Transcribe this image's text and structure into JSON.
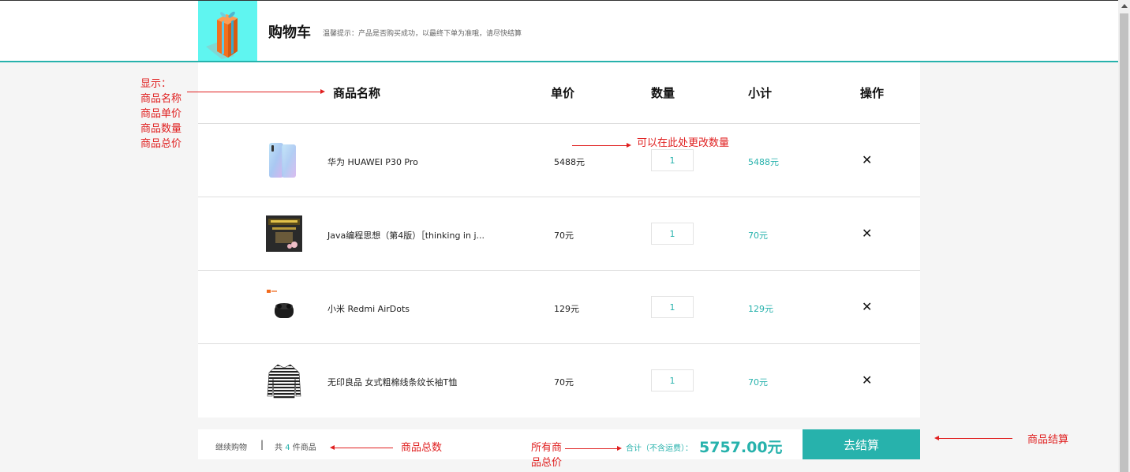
{
  "header": {
    "title": "购物车",
    "tip": "温馨提示：产品是否购买成功，以最终下单为准哦，请尽快结算"
  },
  "table": {
    "headers": {
      "name": "商品名称",
      "price": "单价",
      "quantity": "数量",
      "subtotal": "小计",
      "action": "操作"
    },
    "rows": [
      {
        "name": "华为 HUAWEI P30 Pro",
        "price": "5488元",
        "quantity": "1",
        "subtotal": "5488元",
        "delete": "✕"
      },
      {
        "name": "Java编程思想（第4版）［thinking in j...",
        "price": "70元",
        "quantity": "1",
        "subtotal": "70元",
        "delete": "✕"
      },
      {
        "name": "小米 Redmi AirDots",
        "price": "129元",
        "quantity": "1",
        "subtotal": "129元",
        "delete": "✕"
      },
      {
        "name": "无印良品 女式粗棉线条纹长袖T恤",
        "price": "70元",
        "quantity": "1",
        "subtotal": "70元",
        "delete": "✕"
      }
    ]
  },
  "footer": {
    "continue": "继续购物",
    "separator": "|",
    "count_prefix": "共",
    "count": "4",
    "count_suffix": "件商品",
    "total_label": "合计（不含运费）：",
    "total_value": "5757.00元",
    "checkout": "去结算"
  },
  "annotations": {
    "display": [
      "显示：",
      "商品名称",
      "商品单价",
      "商品数量",
      "商品总价"
    ],
    "change_qty": "可以在此处更改数量",
    "total_count": "商品总数",
    "total_price": [
      "所有商",
      "品总价"
    ],
    "checkout": "商品结算"
  },
  "colors": {
    "accent": "#27b2ac",
    "annotation": "#e02020",
    "logo_bg": "#5ff5f0"
  }
}
